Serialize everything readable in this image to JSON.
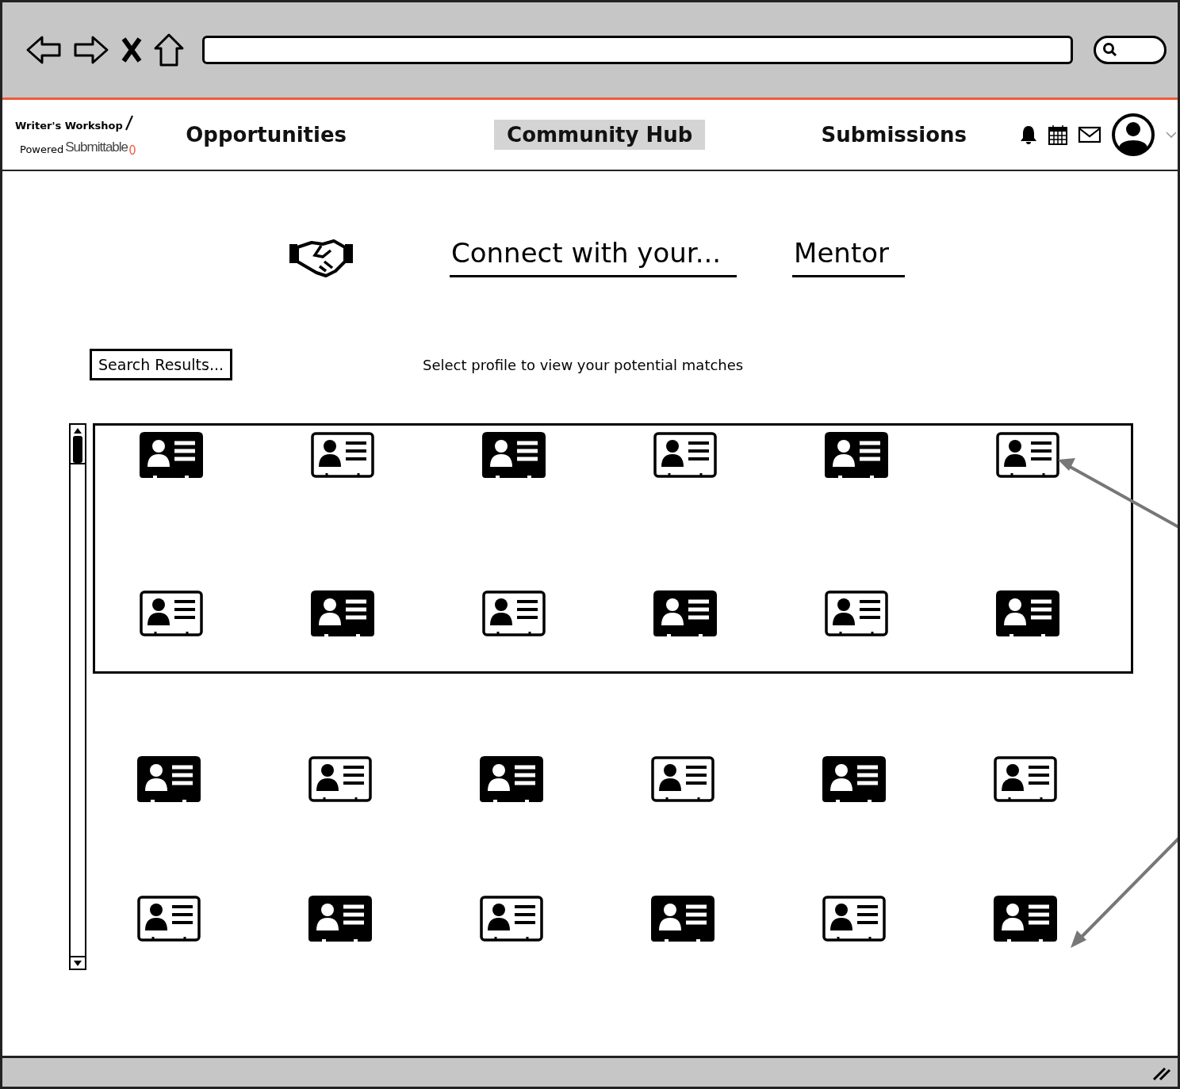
{
  "nav": {
    "brand": {
      "name": "Writer's Workshop",
      "powered": "Powered",
      "partner": "Submittable"
    },
    "tabs": [
      {
        "label": "Opportunities",
        "selected": false
      },
      {
        "label": "Community Hub",
        "selected": true
      },
      {
        "label": "Submissions",
        "selected": false
      }
    ]
  },
  "connect": {
    "prompt": "Connect with your...",
    "role": "Mentor"
  },
  "search_button": "Search Results...",
  "hint": "Select profile to view your potential matches",
  "framed_rows": [
    {
      "cards": [
        {
          "kind": "filled"
        },
        {
          "kind": "outline"
        },
        {
          "kind": "filled"
        },
        {
          "kind": "outline"
        },
        {
          "kind": "filled"
        },
        {
          "kind": "outline"
        }
      ]
    },
    {
      "cards": [
        {
          "kind": "outline"
        },
        {
          "kind": "filled"
        },
        {
          "kind": "outline"
        },
        {
          "kind": "filled"
        },
        {
          "kind": "outline"
        },
        {
          "kind": "filled"
        }
      ]
    }
  ],
  "rows": [
    {
      "cards": [
        {
          "kind": "filled"
        },
        {
          "kind": "outline"
        },
        {
          "kind": "filled"
        },
        {
          "kind": "outline"
        },
        {
          "kind": "filled"
        },
        {
          "kind": "outline"
        }
      ]
    },
    {
      "cards": [
        {
          "kind": "outline"
        },
        {
          "kind": "filled"
        },
        {
          "kind": "outline"
        },
        {
          "kind": "filled"
        },
        {
          "kind": "outline"
        },
        {
          "kind": "filled"
        }
      ]
    }
  ]
}
